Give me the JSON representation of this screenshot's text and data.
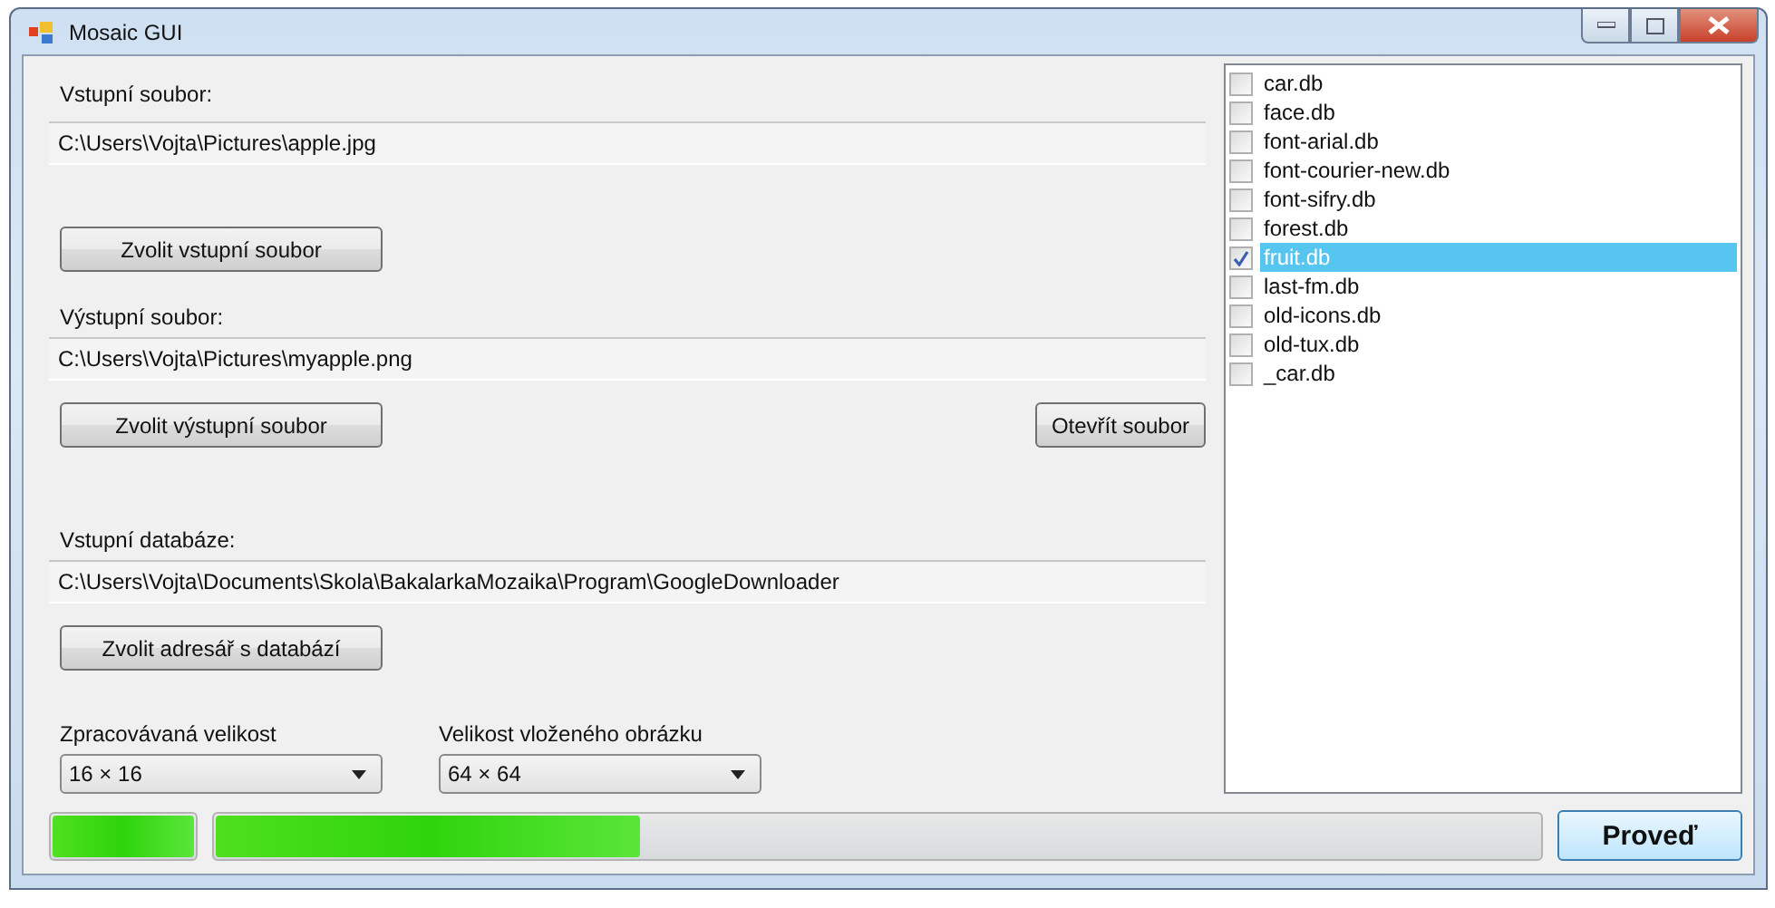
{
  "window": {
    "title": "Mosaic GUI"
  },
  "input_file": {
    "label": "Vstupní soubor:",
    "value": "C:\\Users\\Vojta\\Pictures\\apple.jpg",
    "button": "Zvolit vstupní soubor"
  },
  "output_file": {
    "label": "Výstupní soubor:",
    "value": "C:\\Users\\Vojta\\Pictures\\myapple.png",
    "button": "Zvolit výstupní soubor",
    "open_button": "Otevřít soubor"
  },
  "input_database": {
    "label": "Vstupní databáze:",
    "value": "C:\\Users\\Vojta\\Documents\\Skola\\BakalarkaMozaika\\Program\\GoogleDownloader",
    "button": "Zvolit adresář s databází"
  },
  "dropdowns": [
    {
      "label": "Zpracovávaná velikost",
      "value": "16 × 16"
    },
    {
      "label": "Velikost vloženého obrázku",
      "value": "64 × 64"
    }
  ],
  "databases": [
    {
      "name": "car.db",
      "checked": false,
      "selected": false
    },
    {
      "name": "face.db",
      "checked": false,
      "selected": false
    },
    {
      "name": "font-arial.db",
      "checked": false,
      "selected": false
    },
    {
      "name": "font-courier-new.db",
      "checked": false,
      "selected": false
    },
    {
      "name": "font-sifry.db",
      "checked": false,
      "selected": false
    },
    {
      "name": "forest.db",
      "checked": false,
      "selected": false
    },
    {
      "name": "fruit.db",
      "checked": true,
      "selected": true
    },
    {
      "name": "last-fm.db",
      "checked": false,
      "selected": false
    },
    {
      "name": "old-icons.db",
      "checked": false,
      "selected": false
    },
    {
      "name": "old-tux.db",
      "checked": false,
      "selected": false
    },
    {
      "name": "_car.db",
      "checked": false,
      "selected": false
    }
  ],
  "progress": [
    {
      "level": 1
    },
    {
      "level": 0.32
    }
  ],
  "run_button": "Proveď"
}
